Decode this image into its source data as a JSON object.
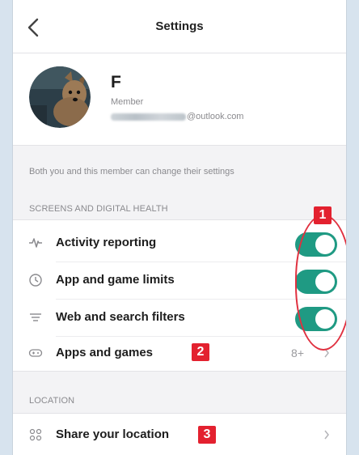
{
  "header": {
    "title": "Settings"
  },
  "profile": {
    "name": "F",
    "role": "Member",
    "email_domain": "@outlook.com"
  },
  "note": "Both you and this member can change their settings",
  "sections": [
    {
      "label": "SCREENS AND DIGITAL HEALTH",
      "items": [
        {
          "label": "Activity reporting",
          "icon": "activity-pulse-icon",
          "toggle": true
        },
        {
          "label": "App and game limits",
          "icon": "clock-icon",
          "toggle": true
        },
        {
          "label": "Web and search filters",
          "icon": "filter-icon",
          "toggle": true
        },
        {
          "label": "Apps and games",
          "icon": "gamepad-icon",
          "value": "8+"
        }
      ]
    },
    {
      "label": "LOCATION",
      "items": [
        {
          "label": "Share your location",
          "icon": "people-icon"
        }
      ]
    }
  ],
  "annotations": {
    "badge_1": "1",
    "badge_2": "2",
    "badge_3": "3"
  },
  "colors": {
    "toggle_on": "#1f9a83",
    "annotation_red": "#e3212f"
  }
}
